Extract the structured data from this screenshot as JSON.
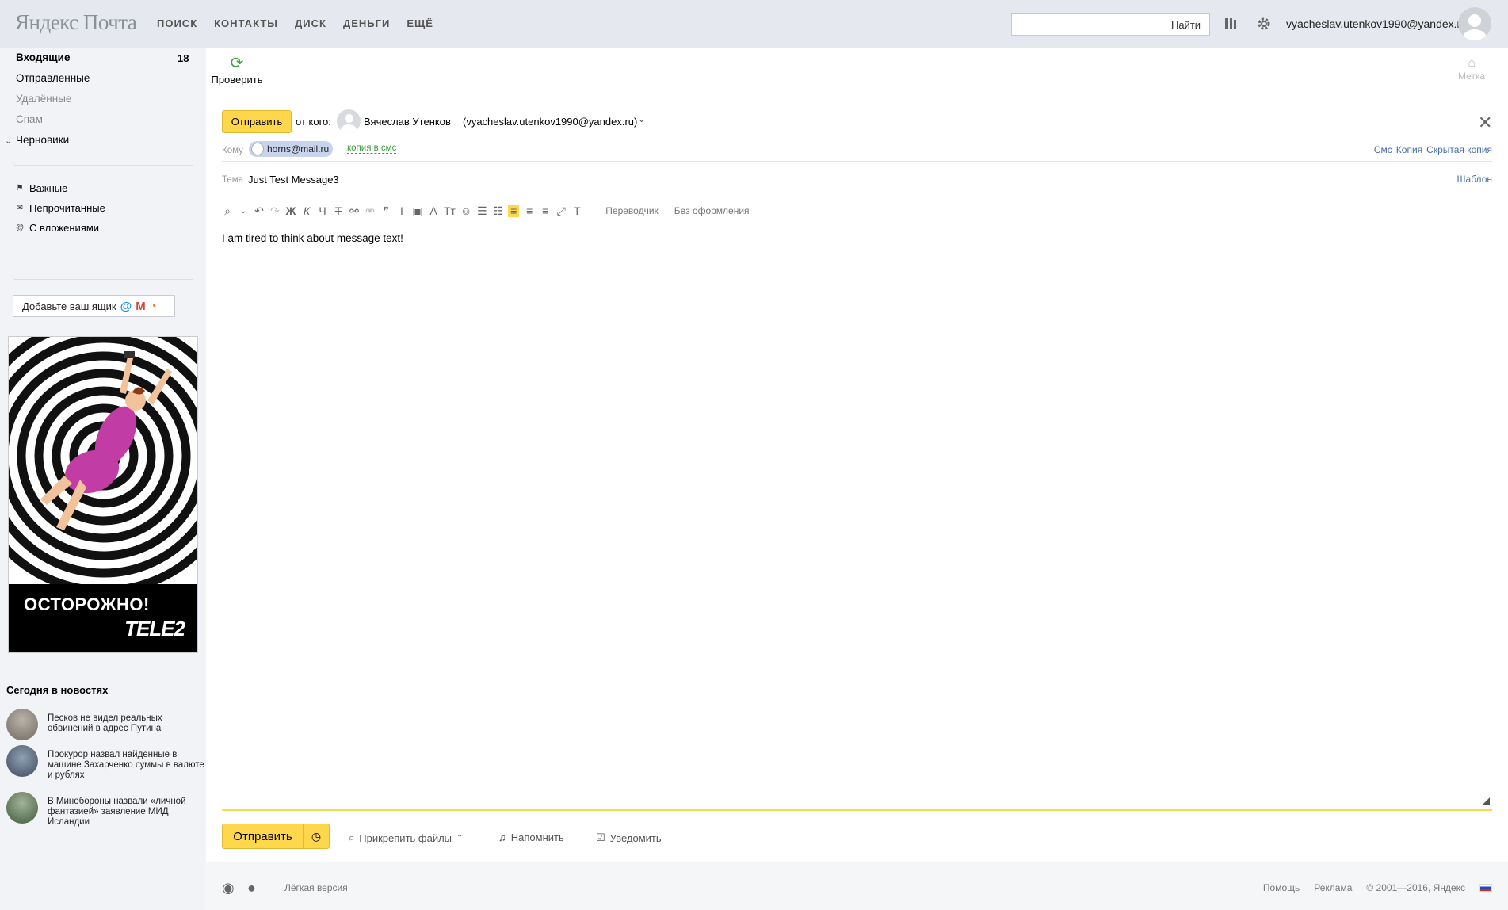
{
  "header": {
    "logo": "Яндекс Почта",
    "nav": [
      "ПОИСК",
      "КОНТАКТЫ",
      "ДИСК",
      "ДЕНЬГИ",
      "ЕЩЁ"
    ],
    "search_placeholder": "",
    "search_button": "Найти",
    "user_email": "vyacheslav.utenkov1990@yandex.ru"
  },
  "sidebar": {
    "folders": [
      {
        "label": "Входящие",
        "count": "18"
      },
      {
        "label": "Отправленные"
      },
      {
        "label": "Удалённые"
      },
      {
        "label": "Спам"
      },
      {
        "label": "Черновики"
      }
    ],
    "labels": [
      {
        "label": "Важные",
        "icon": "flag-icon"
      },
      {
        "label": "Непрочитанные",
        "icon": "envelope-icon"
      },
      {
        "label": "С вложениями",
        "icon": "paperclip-icon"
      }
    ],
    "add_mailbox": "Добавьте ваш ящик",
    "ad": {
      "headline": "ОСТОРОЖНО!",
      "brand": "TELE2"
    },
    "news": {
      "title": "Сегодня в новостях",
      "items": [
        "Песков не видел реальных обвинений в адрес Путина",
        "Прокурор назвал найденные в машине Захарченко суммы в валюте и рублях",
        "В Минобороны назвали «личной фантазией» заявление МИД Исландии"
      ]
    }
  },
  "main": {
    "check_label": "Проверить",
    "label_button": "Метка",
    "compose": {
      "send_label": "Отправить",
      "from_label": "от кого:",
      "from_name": "Вячеслав Утенков",
      "from_email": "(vyacheslav.utenkov1990@yandex.ru)",
      "to_label": "Кому",
      "to_recipient": "horns@mail.ru",
      "sms_copy": "копия в смс",
      "field_links": [
        "Смс",
        "Копия",
        "Скрытая копия"
      ],
      "subject_label": "Тема",
      "subject_value": "Just Test Message3",
      "template_link": "Шаблон",
      "translator": "Переводчик",
      "no_format": "Без оформления",
      "body": "I am tired to think about message text!",
      "attach_label": "Прикрепить файлы",
      "remind_label": "Напомнить",
      "notify_label": "Уведомить"
    }
  },
  "footer": {
    "light_version": "Лёгкая версия",
    "help": "Помощь",
    "ads": "Реклама",
    "copyright": "© 2001—2016, Яндекс"
  },
  "colors": {
    "accent_yellow": "#ffd74c",
    "header_bg": "#e5e8ee",
    "sidebar_bg": "#f2f3f6",
    "link_blue": "#4a6ea6",
    "sms_green": "#3a9b3a"
  }
}
